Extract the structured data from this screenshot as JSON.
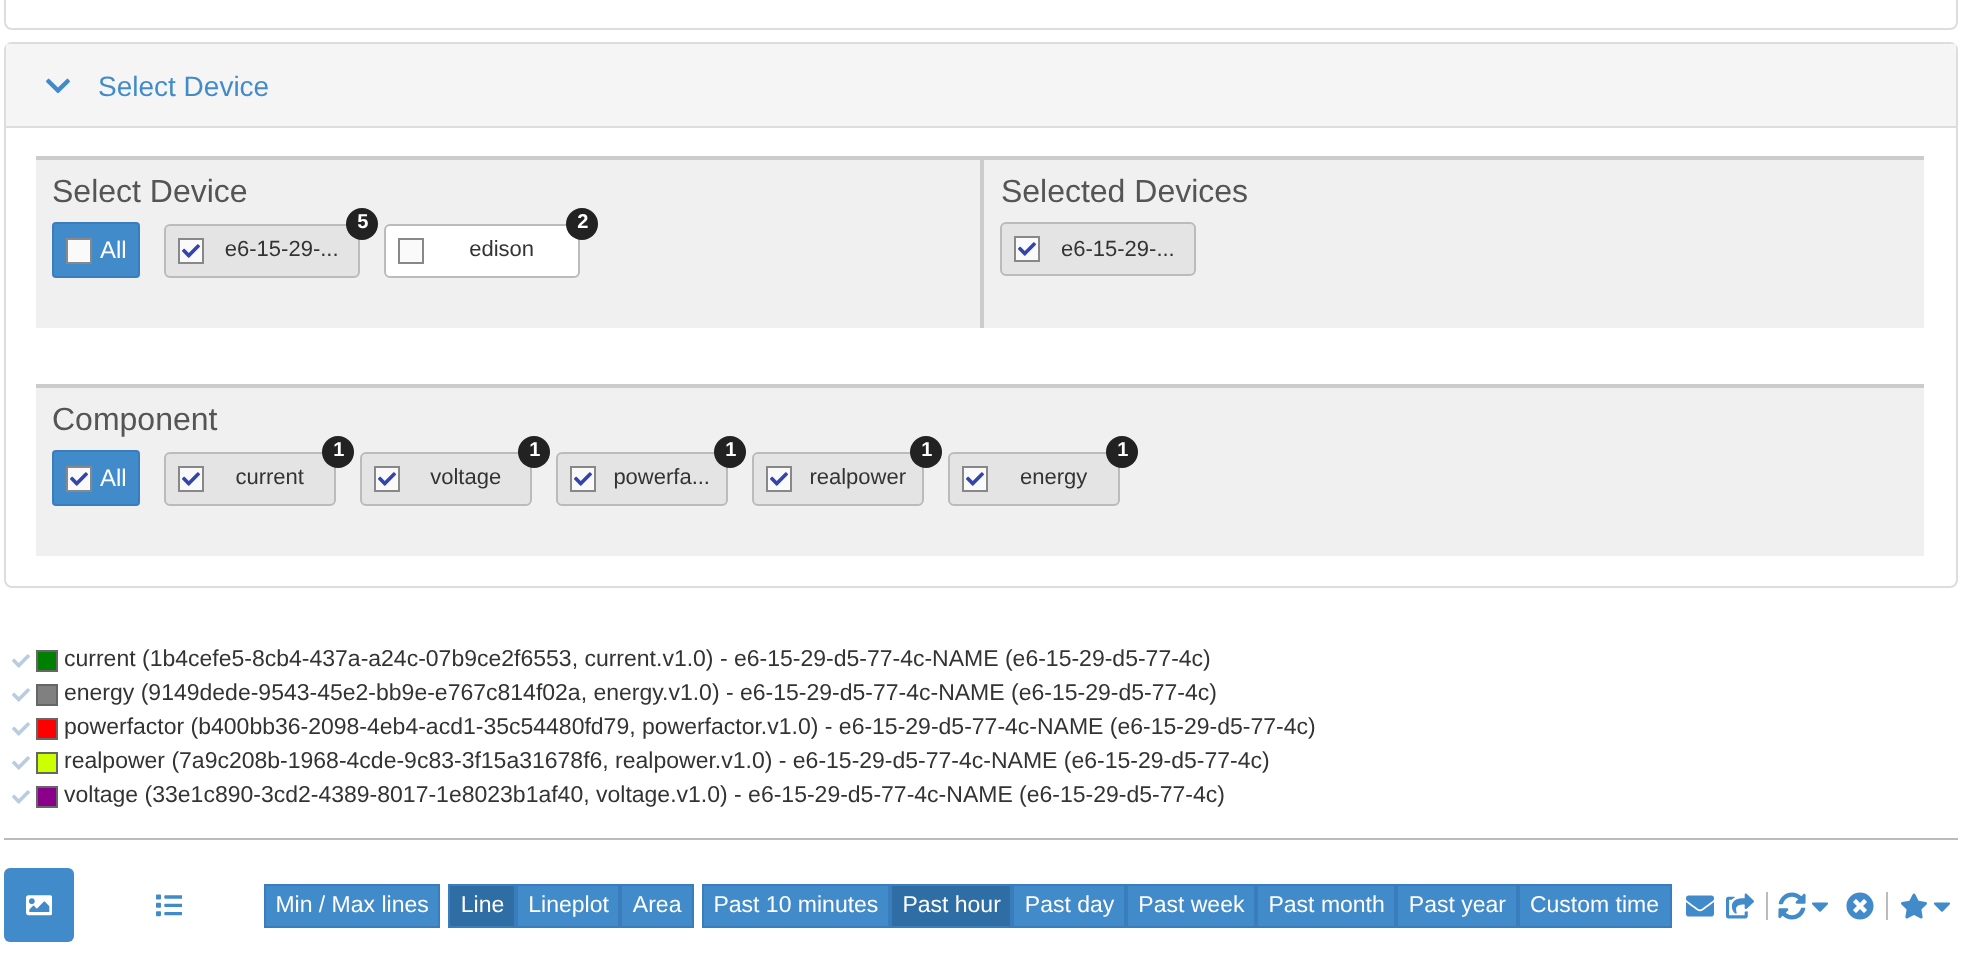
{
  "panel": {
    "title": "Select Device",
    "expanded": true
  },
  "select_device": {
    "title": "Select Device",
    "all": {
      "label": "All",
      "checked": false
    },
    "devices": [
      {
        "label": "e6-15-29-...",
        "checked": true,
        "count": "5"
      },
      {
        "label": "edison",
        "checked": false,
        "count": "2"
      }
    ]
  },
  "selected_devices": {
    "title": "Selected Devices",
    "devices": [
      {
        "label": "e6-15-29-...",
        "checked": true
      }
    ]
  },
  "component": {
    "title": "Component",
    "all": {
      "label": "All",
      "checked": true
    },
    "items": [
      {
        "label": "current",
        "checked": true,
        "count": "1"
      },
      {
        "label": "voltage",
        "checked": true,
        "count": "1"
      },
      {
        "label": "powerfa...",
        "checked": true,
        "count": "1"
      },
      {
        "label": "realpower",
        "checked": true,
        "count": "1"
      },
      {
        "label": "energy",
        "checked": true,
        "count": "1"
      }
    ]
  },
  "legend": [
    {
      "text": "current (1b4cefe5-8cb4-437a-a24c-07b9ce2f6553, current.v1.0) - e6-15-29-d5-77-4c-NAME (e6-15-29-d5-77-4c)",
      "color": "#008000"
    },
    {
      "text": "energy (9149dede-9543-45e2-bb9e-e767c814f02a, energy.v1.0) - e6-15-29-d5-77-4c-NAME (e6-15-29-d5-77-4c)",
      "color": "#808080"
    },
    {
      "text": "powerfactor (b400bb36-2098-4eb4-acd1-35c54480fd79, powerfactor.v1.0) - e6-15-29-d5-77-4c-NAME (e6-15-29-d5-77-4c)",
      "color": "#ff0000"
    },
    {
      "text": "realpower (7a9c208b-1968-4cde-9c83-3f15a31678f6, realpower.v1.0) - e6-15-29-d5-77-4c-NAME (e6-15-29-d5-77-4c)",
      "color": "#ccff00"
    },
    {
      "text": "voltage (33e1c890-3cd2-4389-8017-1e8023b1af40, voltage.v1.0) - e6-15-29-d5-77-4c-NAME (e6-15-29-d5-77-4c)",
      "color": "#8b008b"
    }
  ],
  "toolbar": {
    "views": [
      {
        "kind": "chart",
        "selected": true
      },
      {
        "kind": "list",
        "selected": false
      }
    ],
    "minmax": {
      "label": "Min / Max lines",
      "selected": false
    },
    "chart_types": [
      {
        "label": "Line",
        "selected": true
      },
      {
        "label": "Lineplot",
        "selected": false
      },
      {
        "label": "Area",
        "selected": false
      }
    ],
    "ranges": [
      {
        "label": "Past 10 minutes",
        "selected": false
      },
      {
        "label": "Past hour",
        "selected": true
      },
      {
        "label": "Past day",
        "selected": false
      },
      {
        "label": "Past week",
        "selected": false
      },
      {
        "label": "Past month",
        "selected": false
      },
      {
        "label": "Past year",
        "selected": false
      },
      {
        "label": "Custom time",
        "selected": false
      }
    ]
  }
}
